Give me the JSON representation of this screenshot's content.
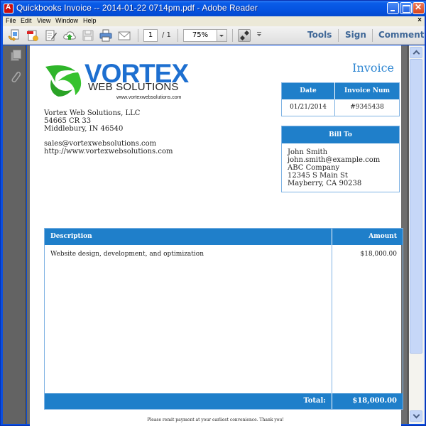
{
  "window": {
    "title": "Quickbooks Invoice -- 2014-01-22 0714pm.pdf - Adobe Reader"
  },
  "menu": {
    "items": [
      "File",
      "Edit",
      "View",
      "Window",
      "Help"
    ],
    "close_doc": "×"
  },
  "toolbar": {
    "icons": [
      "open-icon",
      "create-pdf-icon",
      "edit-sign-icon",
      "cloud-upload-icon",
      "save-icon",
      "print-icon",
      "email-icon"
    ],
    "page_current": "1",
    "page_total": "/ 1",
    "zoom_value": "75%",
    "tools_label": "Tools",
    "sign_label": "Sign",
    "comment_label": "Comment"
  },
  "navpane": {
    "icons": [
      "page-thumbnails-icon",
      "attachments-icon"
    ]
  },
  "scrollbar": {
    "visible_fraction": 0.84,
    "position_fraction": 0.0
  },
  "invoice": {
    "logo": {
      "word": "VORTEX",
      "sub": "WEB SOLUTIONS",
      "url": "www.vortexwebsolutions.com",
      "brand_color": "#1d6fd0",
      "swirl_color": "#2fb52a"
    },
    "title": "Invoice",
    "company": {
      "name": "Vortex Web Solutions, LLC",
      "address1": "54665 CR 33",
      "address2": "Middlebury, IN 46540",
      "email": "sales@vortexwebsolutions.com",
      "website": "http://www.vortexwebsolutions.com"
    },
    "meta": {
      "headers": [
        "Date",
        "Invoice Num"
      ],
      "values": [
        "01/21/2014",
        "#9345438"
      ]
    },
    "bill_to": {
      "header": "Bill To",
      "lines": [
        "John Smith",
        "john.smith@example.com",
        "ABC Company",
        "12345 S Main St",
        "Mayberry, CA 90238"
      ]
    },
    "items": {
      "headers": [
        "Description",
        "Amount"
      ],
      "rows": [
        {
          "description": "Website design, development, and optimization",
          "amount": "$18,000.00"
        }
      ],
      "total_label": "Total:",
      "total_value": "$18,000.00"
    },
    "footer_note": "Please remit payment at your earliest convenience. Thank you!",
    "accent_color": "#1f7fca"
  }
}
